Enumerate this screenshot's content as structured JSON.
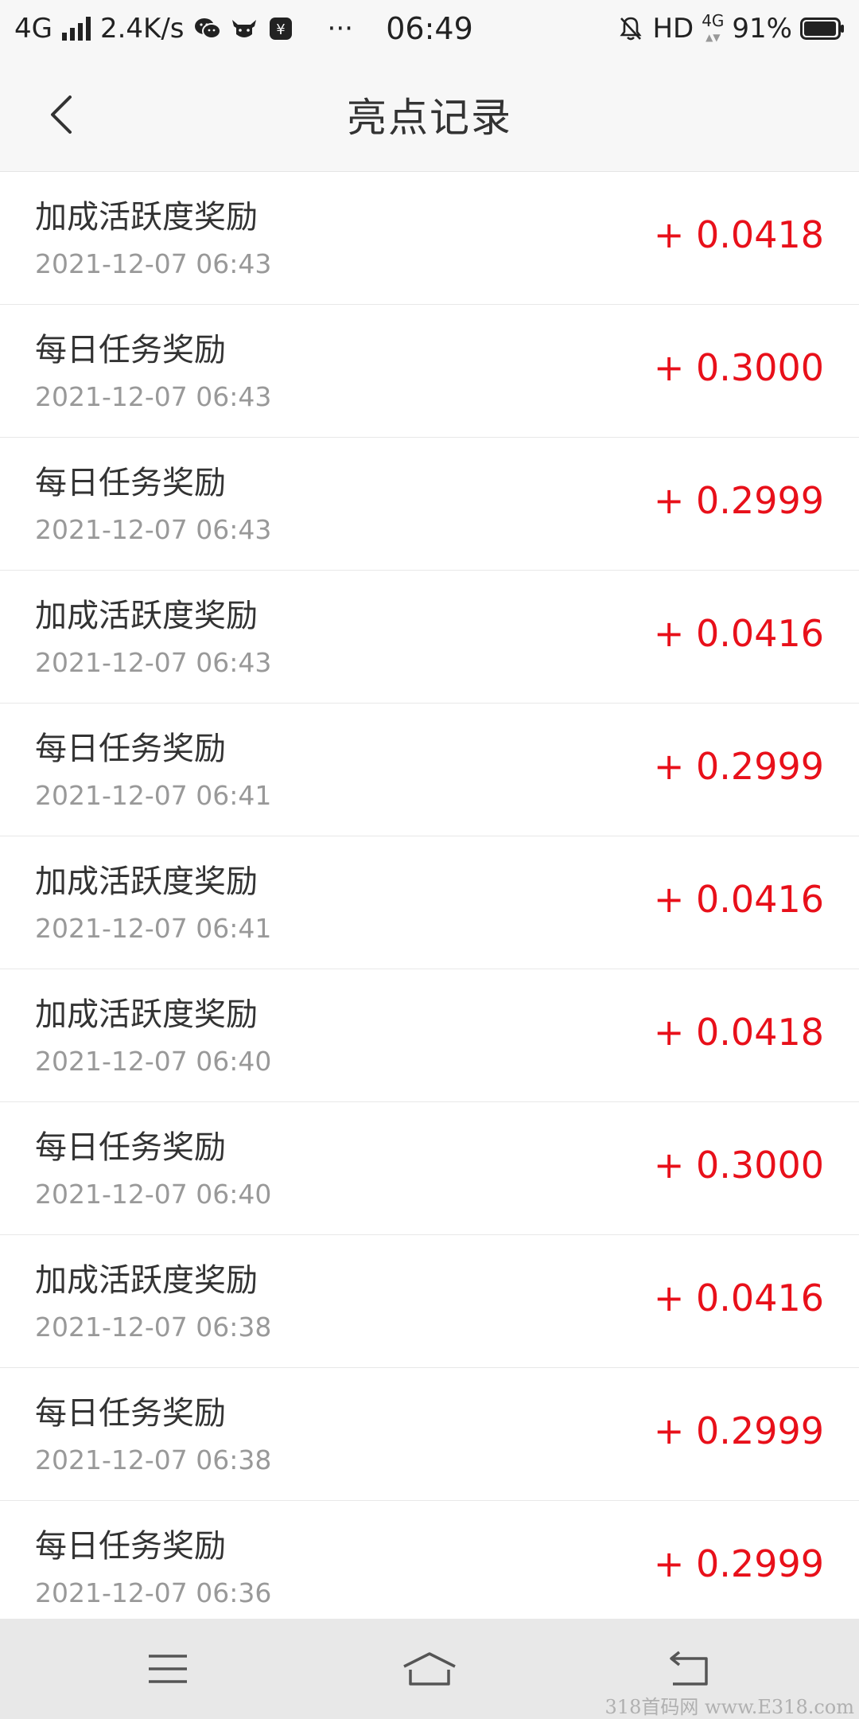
{
  "status_bar": {
    "network": "4G",
    "speed": "2.4K/s",
    "more": "···",
    "time": "06:49",
    "hd": "HD",
    "net_type": "4G",
    "battery": "91%"
  },
  "header": {
    "title": "亮点记录"
  },
  "records": [
    {
      "title": "加成活跃度奖励",
      "time": "2021-12-07 06:43",
      "amount": "+ 0.0418"
    },
    {
      "title": "每日任务奖励",
      "time": "2021-12-07 06:43",
      "amount": "+ 0.3000"
    },
    {
      "title": "每日任务奖励",
      "time": "2021-12-07 06:43",
      "amount": "+ 0.2999"
    },
    {
      "title": "加成活跃度奖励",
      "time": "2021-12-07 06:43",
      "amount": "+ 0.0416"
    },
    {
      "title": "每日任务奖励",
      "time": "2021-12-07 06:41",
      "amount": "+ 0.2999"
    },
    {
      "title": "加成活跃度奖励",
      "time": "2021-12-07 06:41",
      "amount": "+ 0.0416"
    },
    {
      "title": "加成活跃度奖励",
      "time": "2021-12-07 06:40",
      "amount": "+ 0.0418"
    },
    {
      "title": "每日任务奖励",
      "time": "2021-12-07 06:40",
      "amount": "+ 0.3000"
    },
    {
      "title": "加成活跃度奖励",
      "time": "2021-12-07 06:38",
      "amount": "+ 0.0416"
    },
    {
      "title": "每日任务奖励",
      "time": "2021-12-07 06:38",
      "amount": "+ 0.2999"
    },
    {
      "title": "每日任务奖励",
      "time": "2021-12-07 06:36",
      "amount": "+ 0.2999"
    }
  ],
  "watermark": "318首码网 www.E318.com",
  "colors": {
    "amount": "#e8101a",
    "muted": "#999999",
    "text": "#333333"
  }
}
